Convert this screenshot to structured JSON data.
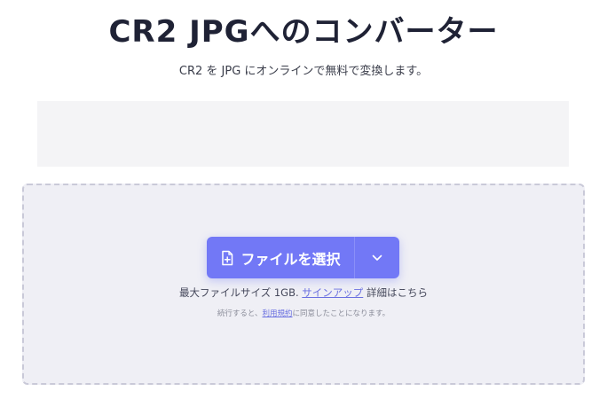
{
  "header": {
    "title": "CR2 JPGへのコンバーター",
    "subtitle": "CR2 を JPG にオンラインで無料で変換します。"
  },
  "uploader": {
    "select_button_label": "ファイルを選択",
    "max_size_text": "最大ファイルサイズ 1GB.",
    "signup_link": "サインアップ",
    "details_text": "詳細はこちら",
    "terms_prefix": "続行すると、",
    "terms_link": "利用規約",
    "terms_suffix": "に同意したことになります。"
  },
  "icons": {
    "select": "file-plus-icon",
    "toggle": "chevron-down-icon"
  },
  "colors": {
    "accent": "#7278f6",
    "dropzone_bg": "#efeff5",
    "link": "#6a70e0"
  }
}
